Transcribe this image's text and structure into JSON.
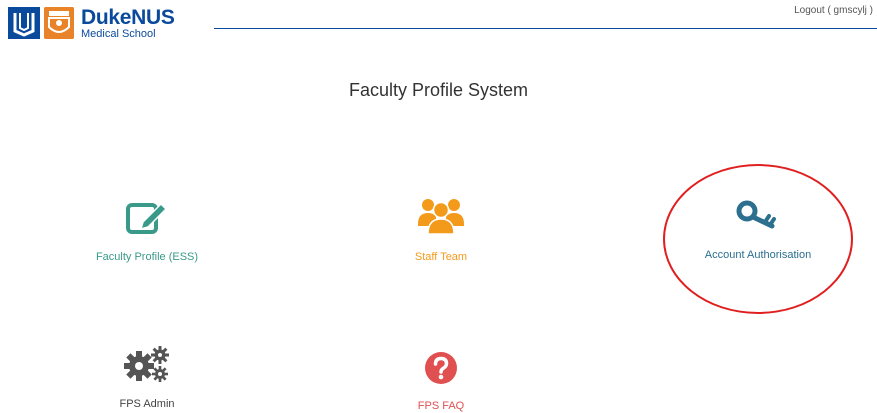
{
  "header": {
    "logo_title_a": "Duke",
    "logo_title_b": "NUS",
    "logo_subtitle": "Medical School",
    "logout_label": "Logout ( gmscylj )"
  },
  "page": {
    "title": "Faculty Profile System"
  },
  "tiles": [
    {
      "label": "Faculty Profile (ESS)",
      "icon": "edit-icon",
      "color": "#3a9a8a"
    },
    {
      "label": "Staff Team",
      "icon": "users-icon",
      "color": "#f39a1b"
    },
    {
      "label": "Account Authorisation",
      "icon": "key-icon",
      "color": "#2c6f8f"
    },
    {
      "label": "FPS Admin",
      "icon": "gears-icon",
      "color": "#444444"
    },
    {
      "label": "FPS FAQ",
      "icon": "question-icon",
      "color": "#e05050"
    }
  ],
  "colors": {
    "brand": "#0a4a9c",
    "highlight": "#e02020"
  }
}
